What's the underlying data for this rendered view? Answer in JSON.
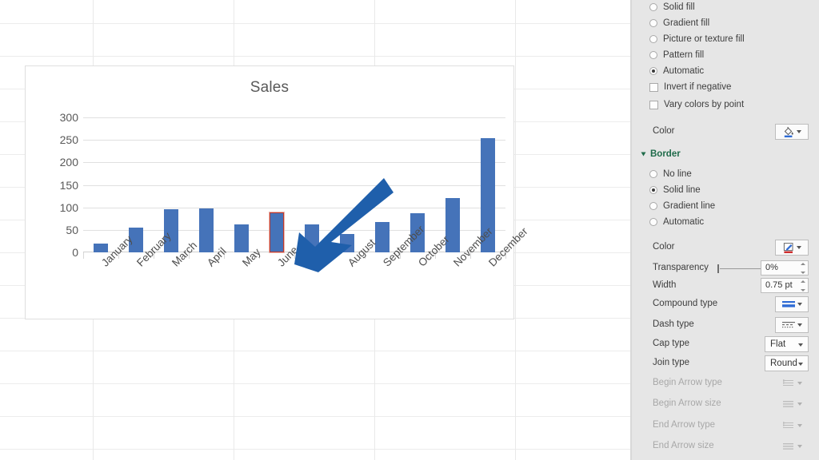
{
  "chart_data": {
    "type": "bar",
    "title": "Sales",
    "xlabel": "",
    "ylabel": "",
    "ylim": [
      0,
      300
    ],
    "yticks": [
      300,
      250,
      200,
      150,
      100,
      50,
      0
    ],
    "grid": true,
    "legend": "none",
    "categories": [
      "January",
      "February",
      "March",
      "April",
      "May",
      "June",
      "July",
      "August",
      "September",
      "October",
      "November",
      "December"
    ],
    "values": [
      20,
      55,
      95,
      97,
      62,
      88,
      62,
      40,
      67,
      87,
      121,
      253
    ],
    "series": [
      {
        "name": "Sales",
        "values": [
          20,
          55,
          95,
          97,
          62,
          88,
          62,
          40,
          67,
          87,
          121,
          253
        ]
      }
    ],
    "bar_color": "#4573b9",
    "selected_point": "June",
    "selected_point_border_color": "#c0392b",
    "annotations": [
      {
        "type": "arrow",
        "color": "#1f5fab",
        "points_to": "June",
        "direction": "down-left"
      }
    ]
  },
  "pane": {
    "fill": {
      "options": [
        {
          "label": "Solid fill",
          "mnemonic": "S",
          "selected": false
        },
        {
          "label": "Gradient fill",
          "mnemonic": "G",
          "selected": false
        },
        {
          "label": "Picture or texture fill",
          "mnemonic": "i",
          "selected": false
        },
        {
          "label": "Pattern fill",
          "mnemonic": "a",
          "selected": false
        },
        {
          "label": "Automatic",
          "mnemonic": "u",
          "selected": true
        }
      ],
      "checkboxes": [
        {
          "label": "Invert if negative",
          "checked": false
        },
        {
          "label": "Vary colors by point",
          "checked": false
        }
      ],
      "color_label": "Color",
      "color_button_icon": "fill-bucket-icon"
    },
    "border": {
      "section_title": "Border",
      "options": [
        {
          "label": "No line",
          "selected": false
        },
        {
          "label": "Solid line",
          "selected": true
        },
        {
          "label": "Gradient line",
          "selected": false
        },
        {
          "label": "Automatic",
          "selected": false
        }
      ],
      "color_label": "Color",
      "color_button_icon": "pen-color-icon",
      "transparency_label": "Transparency",
      "transparency_value": "0%",
      "width_label": "Width",
      "width_value": "0.75 pt",
      "compound_type_label": "Compound type",
      "compound_type_icon": "compound-line-icon",
      "dash_type_label": "Dash type",
      "dash_type_icon": "dash-line-icon",
      "cap_type_label": "Cap type",
      "cap_type_value": "Flat",
      "join_type_label": "Join type",
      "join_type_value": "Round",
      "begin_arrow_type_label": "Begin Arrow type",
      "begin_arrow_size_label": "Begin Arrow size",
      "end_arrow_type_label": "End Arrow type",
      "end_arrow_size_label": "End Arrow size"
    }
  }
}
